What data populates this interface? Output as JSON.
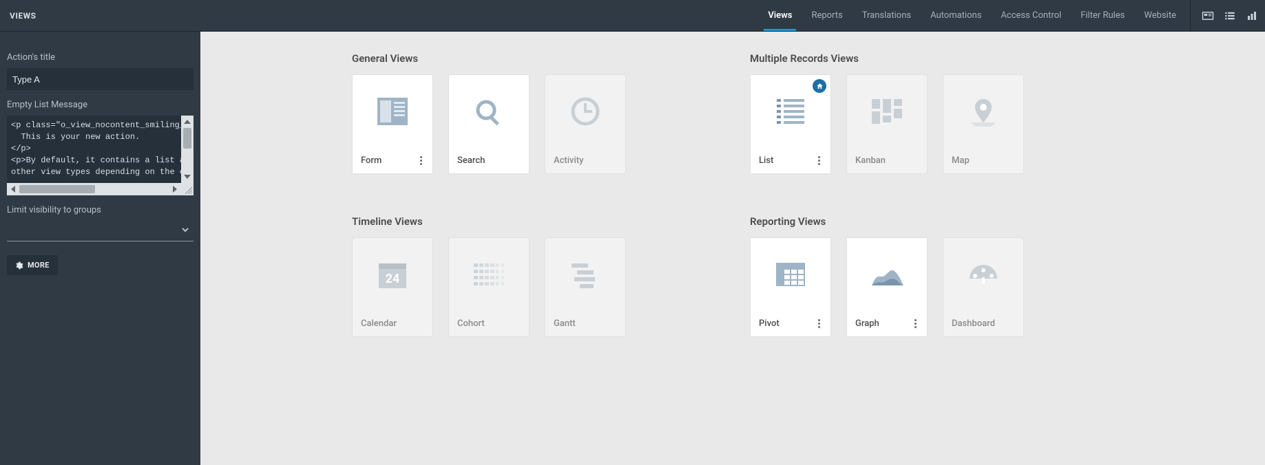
{
  "topbar": {
    "left_title": "VIEWS",
    "tabs": [
      {
        "label": "Views",
        "active": true
      },
      {
        "label": "Reports",
        "active": false
      },
      {
        "label": "Translations",
        "active": false
      },
      {
        "label": "Automations",
        "active": false
      },
      {
        "label": "Access Control",
        "active": false
      },
      {
        "label": "Filter Rules",
        "active": false
      },
      {
        "label": "Website",
        "active": false
      }
    ],
    "icons": [
      "card-view-icon",
      "list-view-icon",
      "chart-view-icon"
    ]
  },
  "sidebar": {
    "action_title_label": "Action's title",
    "action_title_value": "Type A",
    "empty_list_label": "Empty List Message",
    "empty_list_code": "<p class=\"o_view_nocontent_smiling_face\">\n  This is your new action.\n</p>\n<p>By default, it contains a list and a\nother view types depending on the optio",
    "groups_label": "Limit visibility to groups",
    "groups_value": "",
    "more_button": "MORE"
  },
  "sections": [
    {
      "title": "General Views",
      "cards": [
        {
          "label": "Form",
          "enabled": true,
          "kebab": true,
          "icon": "form"
        },
        {
          "label": "Search",
          "enabled": true,
          "kebab": false,
          "icon": "search"
        },
        {
          "label": "Activity",
          "enabled": false,
          "kebab": false,
          "icon": "activity"
        }
      ]
    },
    {
      "title": "Timeline Views",
      "cards": [
        {
          "label": "Calendar",
          "enabled": false,
          "kebab": false,
          "icon": "calendar"
        },
        {
          "label": "Cohort",
          "enabled": false,
          "kebab": false,
          "icon": "cohort"
        },
        {
          "label": "Gantt",
          "enabled": false,
          "kebab": false,
          "icon": "gantt"
        }
      ]
    },
    {
      "title": "Multiple Records Views",
      "cards": [
        {
          "label": "List",
          "enabled": true,
          "kebab": true,
          "icon": "list",
          "home": true
        },
        {
          "label": "Kanban",
          "enabled": false,
          "kebab": false,
          "icon": "kanban"
        },
        {
          "label": "Map",
          "enabled": false,
          "kebab": false,
          "icon": "map"
        }
      ]
    },
    {
      "title": "Reporting Views",
      "cards": [
        {
          "label": "Pivot",
          "enabled": true,
          "kebab": true,
          "icon": "pivot"
        },
        {
          "label": "Graph",
          "enabled": true,
          "kebab": true,
          "icon": "graph"
        },
        {
          "label": "Dashboard",
          "enabled": false,
          "kebab": false,
          "icon": "dashboard"
        }
      ]
    }
  ]
}
